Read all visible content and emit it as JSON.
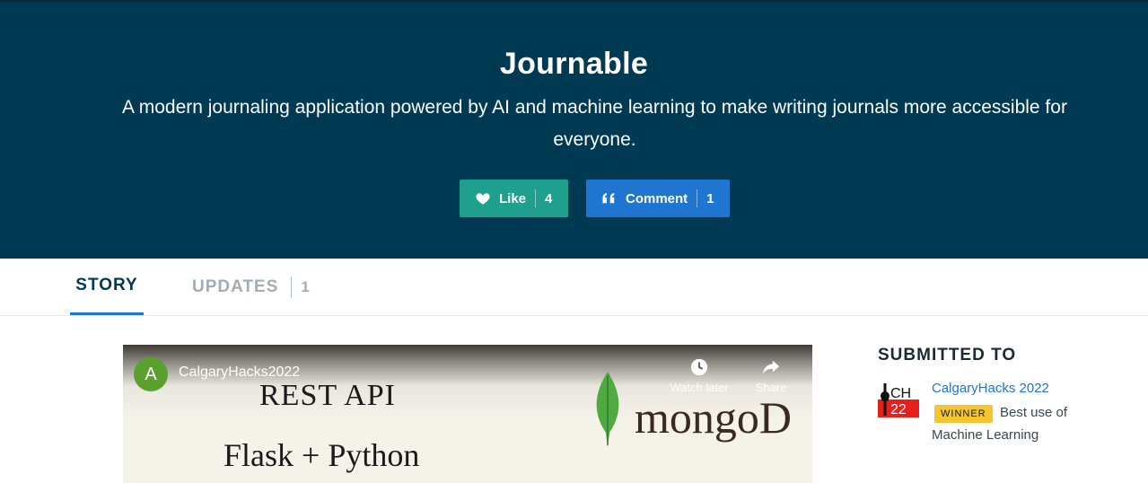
{
  "project": {
    "title": "Journable",
    "tagline": "A modern journaling application powered by AI and machine learning to make writing journals more accessible for everyone."
  },
  "actions": {
    "like": {
      "label": "Like",
      "count": "4",
      "icon": "heart-icon"
    },
    "comment": {
      "label": "Comment",
      "count": "1",
      "icon": "quote-icon"
    }
  },
  "tabs": [
    {
      "label": "STORY",
      "active": true
    },
    {
      "label": "UPDATES",
      "count": "1",
      "active": false
    }
  ],
  "video": {
    "channel_initial": "A",
    "channel_name": "CalgaryHacks2022",
    "watch_later": "Watch later",
    "share": "Share",
    "slide_line1": "REST API",
    "slide_line2": "Flask + Python",
    "slide_logo_text": "mongoD"
  },
  "sidebar": {
    "heading": "SUBMITTED TO",
    "hackathon": {
      "name": "CalgaryHacks 2022",
      "logo_text": "CH22",
      "badge": "WINNER",
      "prize_line1": "Best use of",
      "prize_line2": "Machine Learning"
    }
  },
  "colors": {
    "hero_bg": "#003a52",
    "like_bg": "#1fa08f",
    "comment_bg": "#1e76d0",
    "tab_active": "#003a52",
    "tab_underline": "#1e76d0",
    "badge_bg": "#f2c531",
    "link": "#1e76d0"
  }
}
